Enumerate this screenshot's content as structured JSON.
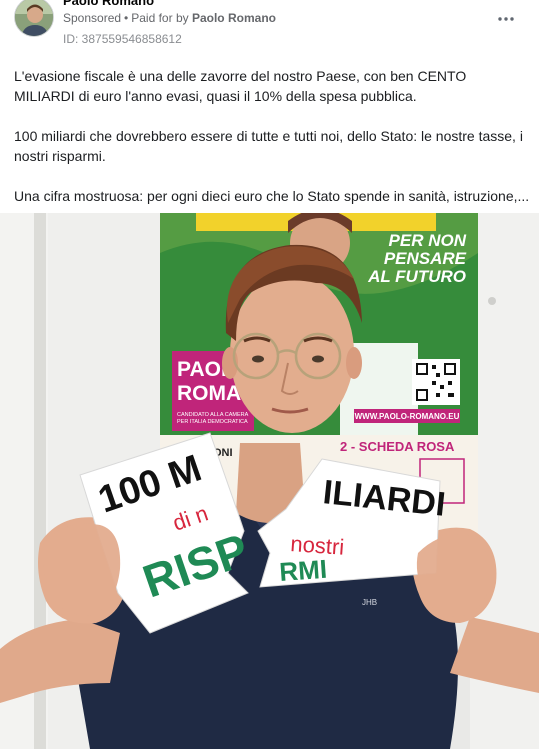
{
  "post": {
    "advertiser_name": "Paolo Romano",
    "sponsored_label": "Sponsored",
    "paid_for_prefix": "Paid for by",
    "paid_for_name": "Paolo Romano",
    "ad_id": "ID: 387559546858612",
    "body_paragraphs": [
      "L'evasione fiscale è una delle zavorre del nostro Paese, con ben CENTO MILIARDI di euro l'anno evasi, quasi il 10% della spesa pubblica.",
      "100 miliardi che dovrebbero essere di tutte e tutti noi, dello Stato: le nostre tasse, i nostri risparmi.",
      "Una cifra mostruosa: per ogni dieci euro che lo Stato spende in sanità, istruzione,..."
    ]
  },
  "photo": {
    "poster": {
      "slogan_lines": [
        "PER NON",
        "PENSARE",
        "AL FUTURO"
      ],
      "name_lines": [
        "PAOL",
        "ROMA"
      ],
      "candidate_lines": [
        "CANDIDATO ALLA CAMERA",
        "PER ITALIA DEMOCRATICA"
      ],
      "website": "WWW.PAOLO-ROMANO.EU",
      "ballot_text": "2 - SCHEDA ROSA",
      "partial_word": "UONI"
    },
    "sign_left": {
      "line1": "100 M",
      "line2": "di n",
      "line3": "RISP"
    },
    "sign_right": {
      "line1": "ILIARDI",
      "line2": "nostri",
      "line3": "RMI"
    },
    "shirt_logo": "JHB"
  },
  "colors": {
    "poster_green": "#2f8a3a",
    "poster_magenta": "#c0257a",
    "poster_yellow": "#f2d22b",
    "shirt_navy": "#1f2a44",
    "marker_black": "#111111",
    "marker_red": "#d7263d",
    "marker_green": "#1f8a55"
  },
  "icons": {
    "more": "more-horizontal-icon",
    "qr": "qr-code-icon"
  }
}
